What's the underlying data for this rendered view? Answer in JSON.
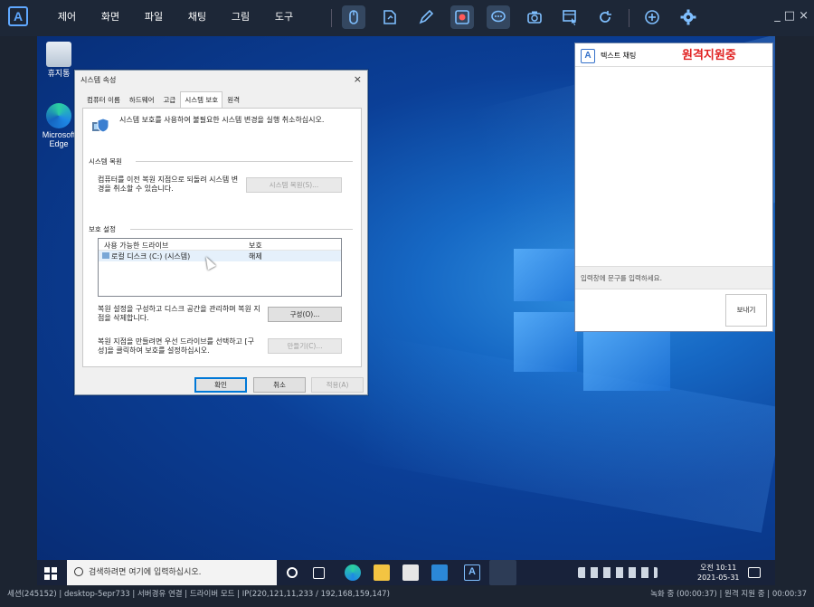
{
  "topbar": {
    "logo": "A",
    "menus": [
      "제어",
      "화면",
      "파일",
      "채팅",
      "그림",
      "도구"
    ],
    "tools": [
      "mouse-icon",
      "file-transfer-icon",
      "pen-icon",
      "record-icon",
      "chat-icon",
      "camera-icon",
      "screen-select-icon",
      "refresh-icon",
      "add-icon",
      "settings-icon"
    ],
    "window_controls": {
      "minimize": "_",
      "maximize": "□",
      "close": "×"
    }
  },
  "desktop": {
    "icons": [
      {
        "label": "휴지통"
      },
      {
        "label": "Microsoft Edge"
      }
    ]
  },
  "system_dialog": {
    "title": "시스템 속성",
    "close": "×",
    "tabs": [
      "컴퓨터 이름",
      "하드웨어",
      "고급",
      "시스템 보호",
      "원격"
    ],
    "active_tab": "시스템 보호",
    "intro": "시스템 보호를 사용하여 불필요한 시스템 변경을 실행 취소하십시오.",
    "restore_header": "시스템 복원",
    "restore_text": "컴퓨터를 이전 복원 지점으로 되돌려 시스템 변경을 취소할 수 있습니다.",
    "restore_button": "시스템 복원(S)...",
    "protect_header": "보호 설정",
    "list_headers": [
      "사용 가능한 드라이브",
      "보호"
    ],
    "drives": [
      {
        "name": "로컬 디스크 (C:) (시스템)",
        "protection": "해제"
      }
    ],
    "config_text": "복원 설정을 구성하고 디스크 공간을 관리하며 복원 지점을 삭제합니다.",
    "config_button": "구성(O)...",
    "create_text": "복원 지점을 만들려면 우선 드라이브를 선택하고 [구성]을 클릭하여 보호를 설정하십시오.",
    "create_button": "만들기(C)...",
    "ok": "확인",
    "cancel": "취소",
    "apply": "적용(A)"
  },
  "chat": {
    "title": "텍스트 채팅",
    "overlay": "원격지원중",
    "input_placeholder": "입력창에 문구를 입력하세요.",
    "send": "보내기"
  },
  "taskbar": {
    "search_placeholder": "검색하려면 여기에 입력하십시오.",
    "time": "오전 10:11",
    "date": "2021-05-31"
  },
  "status": {
    "left": "세션(245152) | desktop-5epr733 | 서버경유 연결 | 드라이버 모드 | IP(220,121,11,233 / 192,168,159,147)",
    "right": "녹화 중 (00:00:37) | 원격 지원 중 | 00:00:37"
  },
  "colors": {
    "accent": "#3370c9",
    "topbar_bg": "#1d2737",
    "overlay_red": "#e02020"
  }
}
